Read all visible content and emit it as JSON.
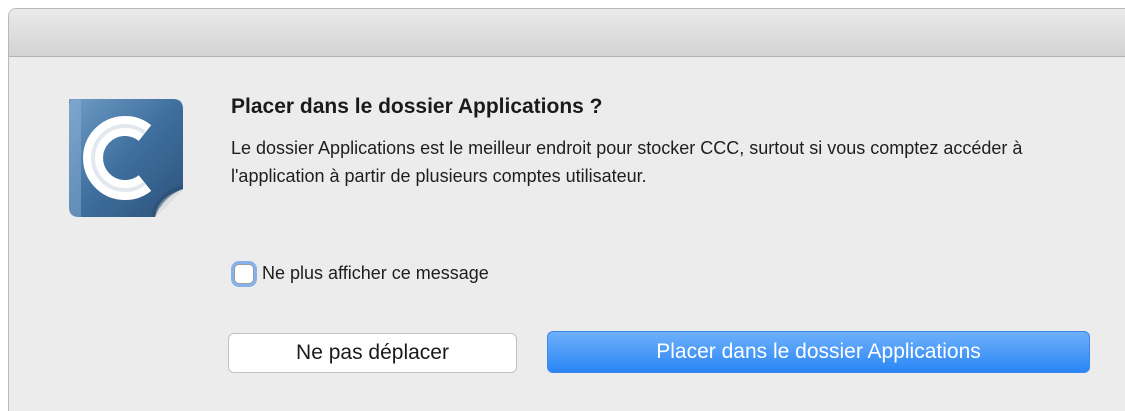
{
  "dialog": {
    "title": "Placer dans le dossier Applications ?",
    "message": "Le dossier Applications est le meilleur endroit pour stocker CCC, surtout si vous comptez accéder à l'application à partir de plusieurs comptes utilisateur.",
    "checkbox": {
      "label": "Ne plus afficher ce message",
      "checked": false
    },
    "buttons": {
      "secondary": "Ne pas déplacer",
      "primary": "Placer dans le dossier Applications"
    },
    "icon": "ccc-app-icon"
  },
  "colors": {
    "primary_button": "#2a86f5",
    "icon_blue": "#3d6f9f"
  }
}
